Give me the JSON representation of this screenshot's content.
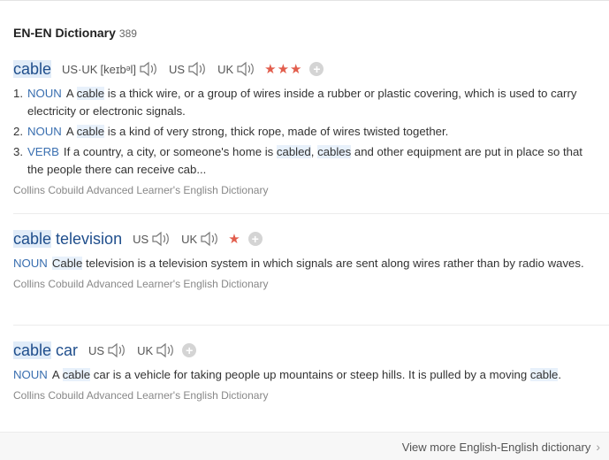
{
  "header": {
    "title": "EN-EN Dictionary",
    "count": "389"
  },
  "entries": [
    {
      "word": "cable",
      "pron": [
        {
          "label": "US·UK",
          "phonetic": "[keɪbᵊl]"
        },
        {
          "label": "US"
        },
        {
          "label": "UK"
        }
      ],
      "stars": "★★★",
      "defs": [
        {
          "num": "1.",
          "pos": "NOUN",
          "pre": "A ",
          "hl": "cable",
          "post": " is a thick wire, or a group of wires inside a rubber or plastic covering, which is used to carry electricity or electronic signals."
        },
        {
          "num": "2.",
          "pos": "NOUN",
          "pre": "A ",
          "hl": "cable",
          "post": " is a kind of very strong, thick rope, made of wires twisted together."
        },
        {
          "num": "3.",
          "pos": "VERB",
          "pre": "If a country, a city, or someone's home is ",
          "hl": "cabled",
          "mid": ", ",
          "hl2": "cables",
          "post": " and other equipment are put in place so that the people there can receive cab..."
        }
      ],
      "source": "Collins Cobuild Advanced Learner's English Dictionary"
    },
    {
      "word_a": "cable",
      "word_b": " television",
      "pron": [
        {
          "label": "US"
        },
        {
          "label": "UK"
        }
      ],
      "stars": "★",
      "def": {
        "pos": "NOUN",
        "hl": "Cable",
        "post": " television is a television system in which signals are sent along wires rather than by radio waves."
      },
      "source": "Collins Cobuild Advanced Learner's English Dictionary"
    },
    {
      "word_a": "cable",
      "word_b": " car",
      "pron": [
        {
          "label": "US"
        },
        {
          "label": "UK"
        }
      ],
      "def": {
        "pos": "NOUN",
        "pre": "A ",
        "hl": "cable",
        "post": " car is a vehicle for taking people up mountains or steep hills. It is pulled by a moving ",
        "hl2": "cable",
        "post2": "."
      },
      "source": "Collins Cobuild Advanced Learner's English Dictionary"
    }
  ],
  "footer": {
    "more_label": "View more English-English dictionary"
  },
  "colors": {
    "accent": "#1f4e8c",
    "star": "#e25d4c",
    "pos": "#3a6fb0",
    "highlight": "#e8f1fb"
  },
  "icons": {
    "speaker": "speaker-icon",
    "add": "plus-icon",
    "chevron": "chevron-right-icon"
  }
}
